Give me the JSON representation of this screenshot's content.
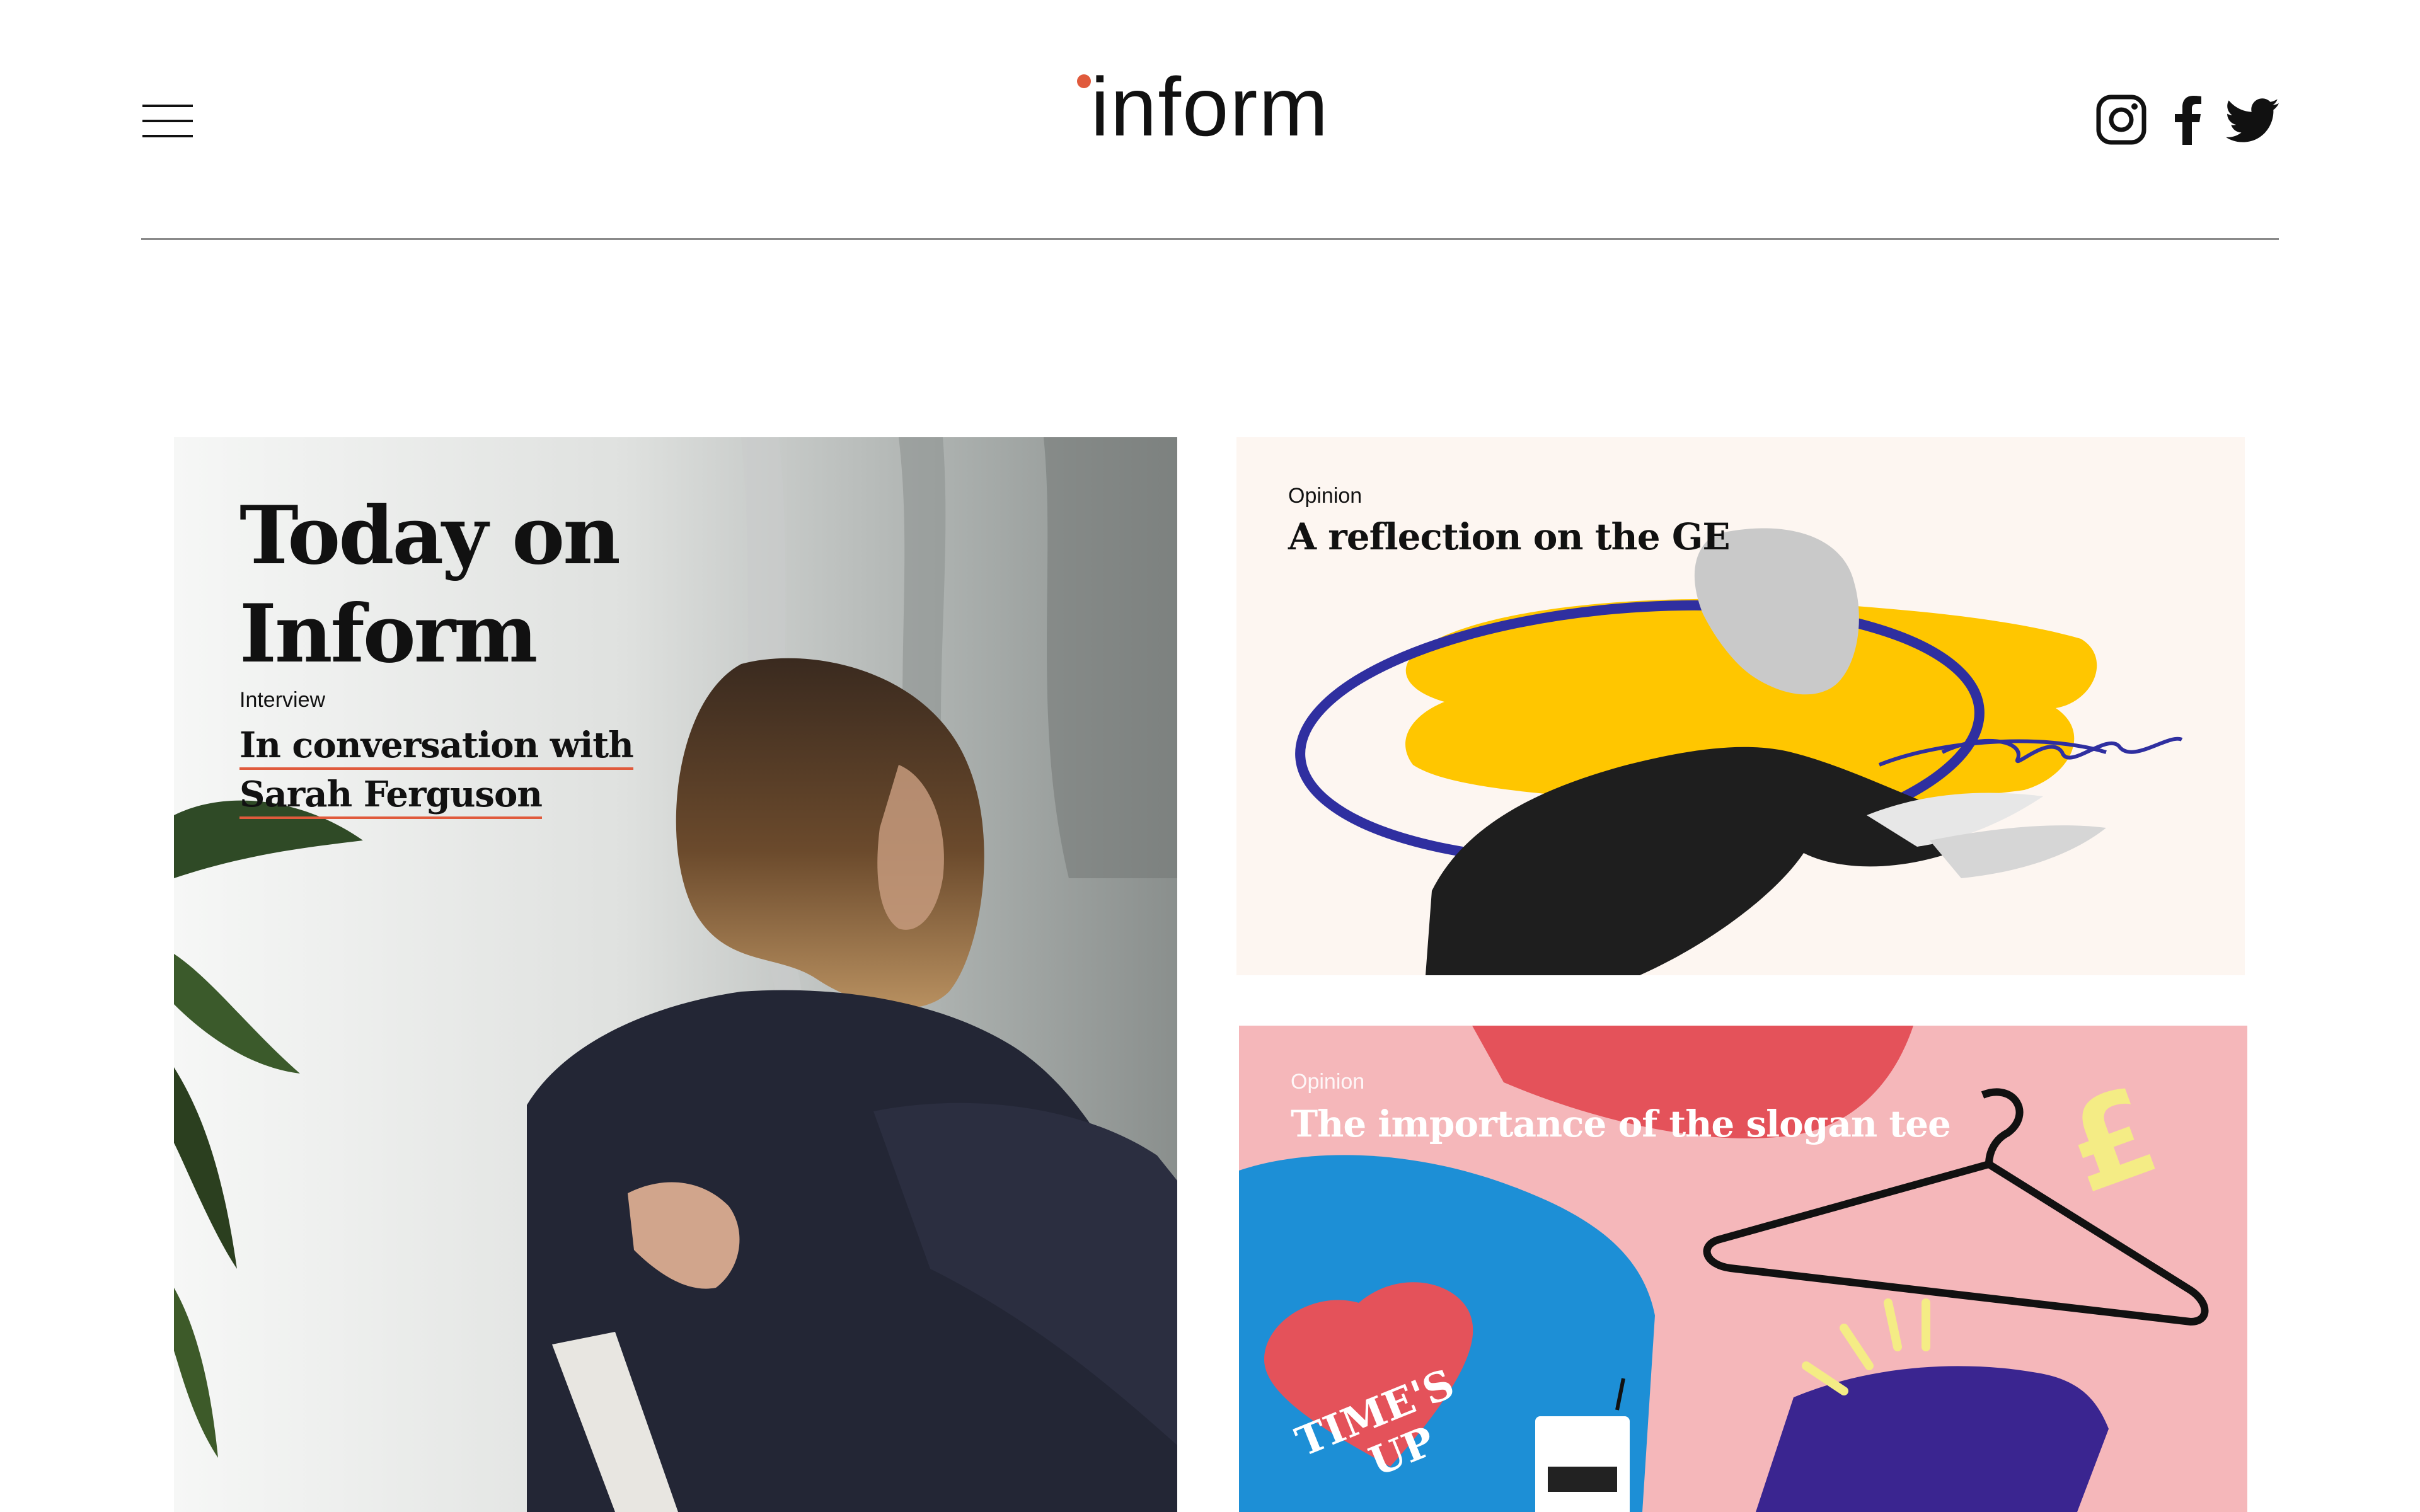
{
  "header": {
    "logo": "inform",
    "menu_label": "menu",
    "social": [
      {
        "name": "instagram-icon"
      },
      {
        "name": "facebook-icon"
      },
      {
        "name": "twitter-icon"
      }
    ],
    "colors": {
      "accent": "#e05a3c",
      "rule": "#8a8a8a"
    }
  },
  "hero": {
    "title": "Today on Inform",
    "kicker": "Interview",
    "headline_line1": "In conversation with",
    "headline_line2": "Sarah Ferguson"
  },
  "cards": [
    {
      "kicker": "Opinion",
      "title": "A reflection on the GE",
      "colors": {
        "background": "#fdf6f1",
        "yellow": "#ffc600",
        "blue_scribble": "#2f2fa0"
      }
    },
    {
      "kicker": "Opinion",
      "title": "The importance of the slogan tee",
      "badge_line1": "TIME'S",
      "badge_line2": "UP",
      "colors": {
        "background": "#f5b7ba",
        "blue": "#1d8fd6",
        "purple": "#3a2590",
        "red": "#e4525a",
        "yellow": "#f4ec85"
      }
    }
  ]
}
